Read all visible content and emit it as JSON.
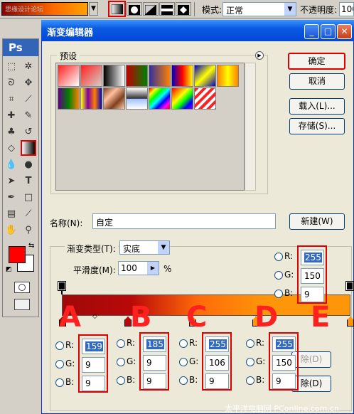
{
  "optbar": {
    "mode_label": "模式:",
    "mode_value": "正常",
    "opacity_label": "不透明度:",
    "opacity_value": "100",
    "preview_watermark": "思缘设计论坛"
  },
  "toolbox": {
    "logo": "Ps"
  },
  "dialog": {
    "title": "渐变编辑器",
    "presets_label": "预设",
    "ok": "确定",
    "cancel": "取消",
    "load": "载入(L)...",
    "save": "存储(S)...",
    "name_label": "名称(N):",
    "name_value": "自定",
    "new_button": "新建(W)",
    "gradient_type_label": "渐变类型(T):",
    "gradient_type_value": "实底",
    "smoothness_label": "平滑度(M):",
    "smoothness_value": "100",
    "smoothness_unit": "%",
    "delete_partial": "除(D)",
    "delete_partial_2": "除(D)"
  },
  "presets": [
    {
      "name": "fg-to-bg",
      "css": "linear-gradient(135deg,#ff2020,#ffffff)"
    },
    {
      "name": "fg-to-transparent",
      "css": "linear-gradient(135deg,#ff2020,rgba(255,255,255,0))"
    },
    {
      "name": "black-white",
      "css": "linear-gradient(90deg,#000,#fff)"
    },
    {
      "name": "red-green",
      "css": "linear-gradient(90deg,#c00000,#008000)"
    },
    {
      "name": "violet-orange",
      "css": "linear-gradient(90deg,#3030a0,#ff8000)"
    },
    {
      "name": "blue-red-yellow",
      "css": "linear-gradient(90deg,#0000c0,#ff0000,#ffff00)"
    },
    {
      "name": "blue-yellow-blue",
      "css": "linear-gradient(135deg,#0000c0,#ffff00,#0000c0)"
    },
    {
      "name": "orange-yellow-orange",
      "css": "linear-gradient(90deg,#ff8000,#ffff00,#ff8000)"
    },
    {
      "name": "violet-green-orange",
      "css": "linear-gradient(90deg,#600080,#008000,#ff8000)"
    },
    {
      "name": "yellow-violet-orange-blue",
      "css": "linear-gradient(90deg,#ffff00,#8000a0,#ff8000,#0000c0)"
    },
    {
      "name": "copper",
      "css": "linear-gradient(135deg,#804020,#ffc0a0,#804020,#ffd0b0)"
    },
    {
      "name": "chrome",
      "css": "linear-gradient(180deg,#ffffff,#303030 50%,#a0c0ff 52%,#ffffff)"
    },
    {
      "name": "spectrum",
      "css": "linear-gradient(135deg,#ff0000,#ffff00,#00ff00,#00ffff,#0000ff,#ff00ff,#ff0000)"
    },
    {
      "name": "transparent-rainbow",
      "css": "linear-gradient(135deg,#ff0000,#ff8000,#ffff00,#00ff00,#0000ff,#8000ff)"
    },
    {
      "name": "transparent-stripes",
      "css": "repeating-linear-gradient(135deg,#ff2020 0 4px,#ffffff 4px 8px)"
    }
  ],
  "stops": [
    {
      "marker": "A",
      "r": "159",
      "g": "9",
      "b": "9"
    },
    {
      "marker": "B",
      "r": "185",
      "g": "9",
      "b": "9"
    },
    {
      "marker": "C",
      "r": "255",
      "g": "106",
      "b": "9"
    },
    {
      "marker": "D",
      "r": "255",
      "g": "150",
      "b": "9"
    },
    {
      "marker": "E",
      "r": "255",
      "g": "150",
      "b": "9"
    }
  ],
  "rgb_labels": {
    "r": "R:",
    "g": "G:",
    "b": "B:"
  },
  "watermark": "太平洋电脑网 PConline.com.cn"
}
